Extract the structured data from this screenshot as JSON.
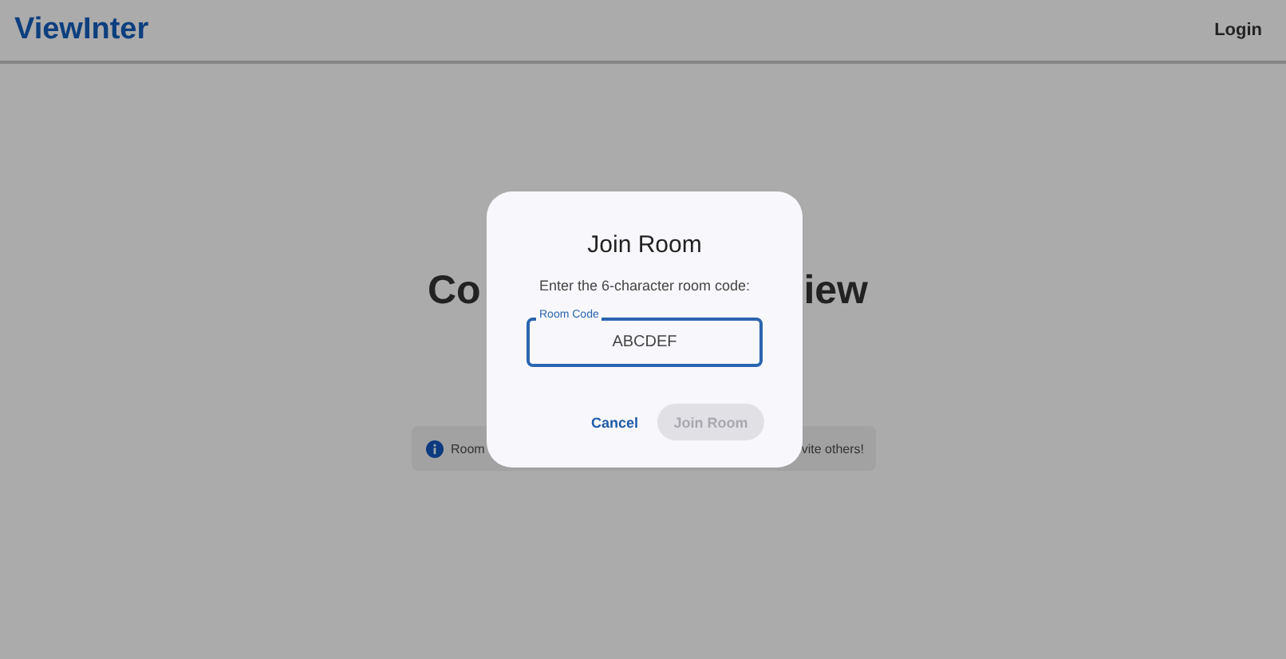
{
  "header": {
    "logo": "ViewInter",
    "login": "Login"
  },
  "background": {
    "heading_start": "Co",
    "heading_end": "iew",
    "info_start": "Room",
    "info_end": "vite others!"
  },
  "dialog": {
    "title": "Join Room",
    "prompt": "Enter the 6-character room code:",
    "field": {
      "label": "Room Code",
      "value": "ABCDEF"
    },
    "buttons": [
      {
        "label": "Cancel",
        "kind": "text",
        "disabled": false
      },
      {
        "label": "Join Room",
        "kind": "filled",
        "disabled": true
      }
    ]
  }
}
